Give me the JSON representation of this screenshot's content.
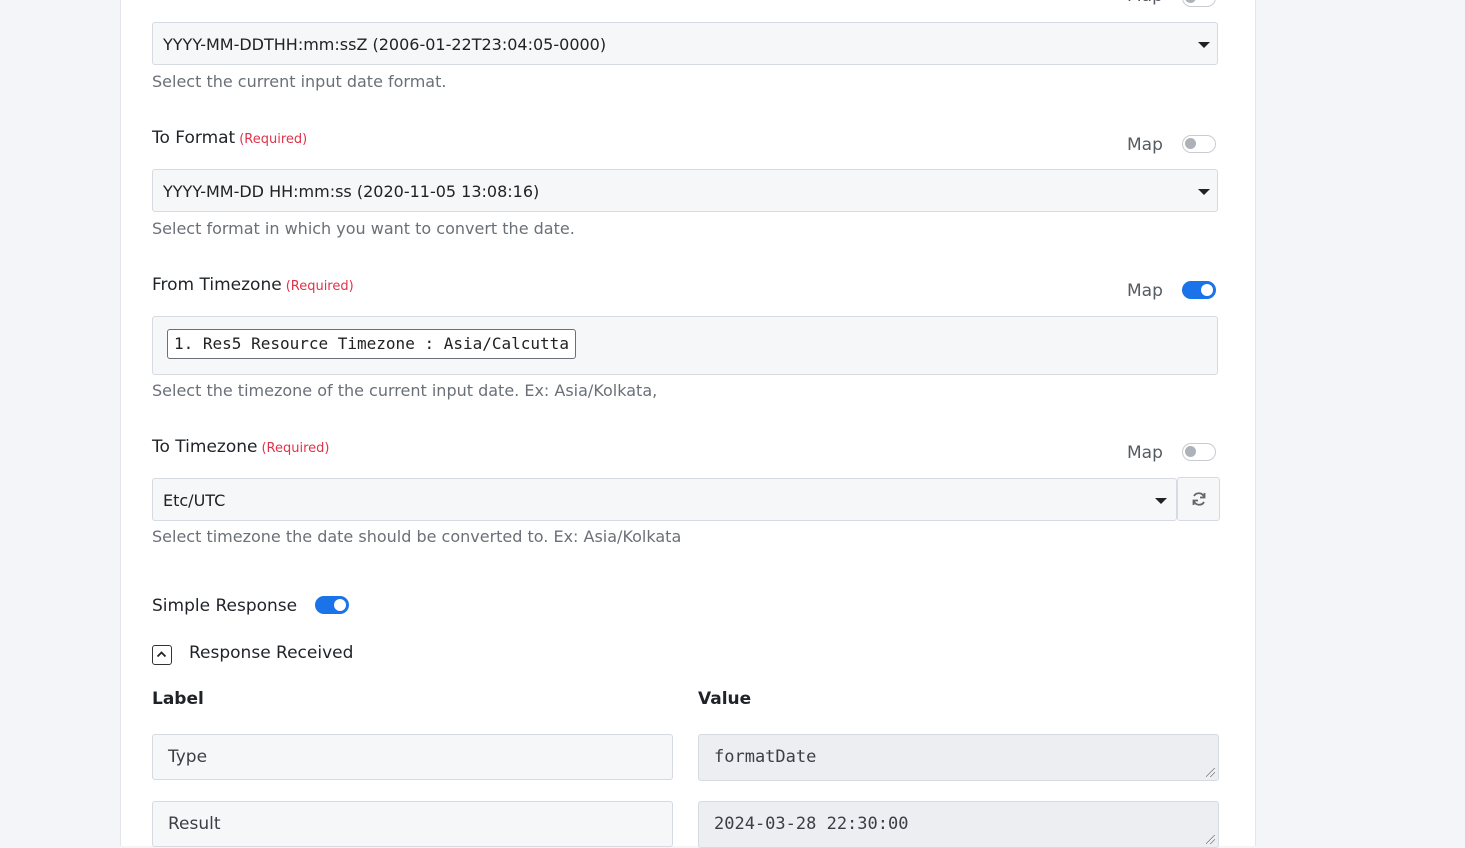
{
  "map_label": "Map",
  "required_tag": "(Required)",
  "from_format": {
    "value": "YYYY-MM-DDTHH:mm:ssZ (2006-01-22T23:04:05-0000)",
    "help": "Select the current input date format.",
    "map_enabled": false
  },
  "to_format": {
    "label": "To Format",
    "value": "YYYY-MM-DD HH:mm:ss (2020-11-05 13:08:16)",
    "help": "Select format in which you want to convert the date.",
    "map_enabled": false
  },
  "from_timezone": {
    "label": "From Timezone",
    "chip": "1. Res5 Resource Timezone : Asia/Calcutta",
    "help": "Select the timezone of the current input date. Ex: Asia/Kolkata,",
    "map_enabled": true
  },
  "to_timezone": {
    "label": "To Timezone",
    "value": "Etc/UTC",
    "help": "Select timezone the date should be converted to. Ex: Asia/Kolkata",
    "map_enabled": false
  },
  "simple_response": {
    "label": "Simple Response",
    "enabled": true
  },
  "response_received": {
    "title": "Response Received",
    "label_header": "Label",
    "value_header": "Value",
    "rows": [
      {
        "label": "Type",
        "value": "formatDate"
      },
      {
        "label": "Result",
        "value": "2024-03-28 22:30:00"
      }
    ]
  },
  "colors": {
    "accent": "#1a73e8",
    "required": "#e0334a"
  },
  "icons": [
    "caret-down-icon",
    "refresh-icon",
    "chevron-up-icon"
  ]
}
